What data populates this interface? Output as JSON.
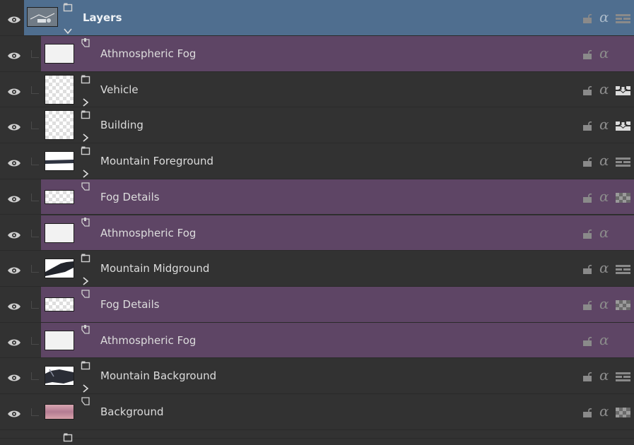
{
  "panel": {
    "root": {
      "label": "Layers"
    },
    "layers": [
      {
        "label": "Athmospheric Fog",
        "kind": "filter-mask",
        "thumb": "white",
        "extra": "none"
      },
      {
        "label": "Vehicle",
        "kind": "group",
        "thumb": "checker",
        "extra": "merge-down-icon"
      },
      {
        "label": "Building",
        "kind": "group",
        "thumb": "checker",
        "extra": "merge-down-icon"
      },
      {
        "label": "Mountain Foreground",
        "kind": "group",
        "thumb": "mountain-strip",
        "extra": "layer-stack-icon"
      },
      {
        "label": "Fog Details",
        "kind": "transparency-mask",
        "thumb": "checker",
        "extra": "checker-icon"
      },
      {
        "label": "Athmospheric Fog",
        "kind": "filter-mask",
        "thumb": "white",
        "extra": "none"
      },
      {
        "label": "Mountain Midground",
        "kind": "group",
        "thumb": "mountain-mid",
        "extra": "layer-stack-icon"
      },
      {
        "label": "Fog Details",
        "kind": "transparency-mask",
        "thumb": "checker",
        "extra": "checker-icon"
      },
      {
        "label": "Athmospheric Fog",
        "kind": "filter-mask",
        "thumb": "white",
        "extra": "none"
      },
      {
        "label": "Mountain Background",
        "kind": "group",
        "thumb": "mountain-bg",
        "extra": "layer-stack-icon"
      },
      {
        "label": "Background",
        "kind": "paint",
        "thumb": "pink-gradient",
        "extra": "checker-icon"
      }
    ],
    "alpha_glyph": "α",
    "colors": {
      "root_highlight": "#4f6e8f",
      "mask_row": "#5e4565",
      "panel_bg": "#323232"
    }
  }
}
